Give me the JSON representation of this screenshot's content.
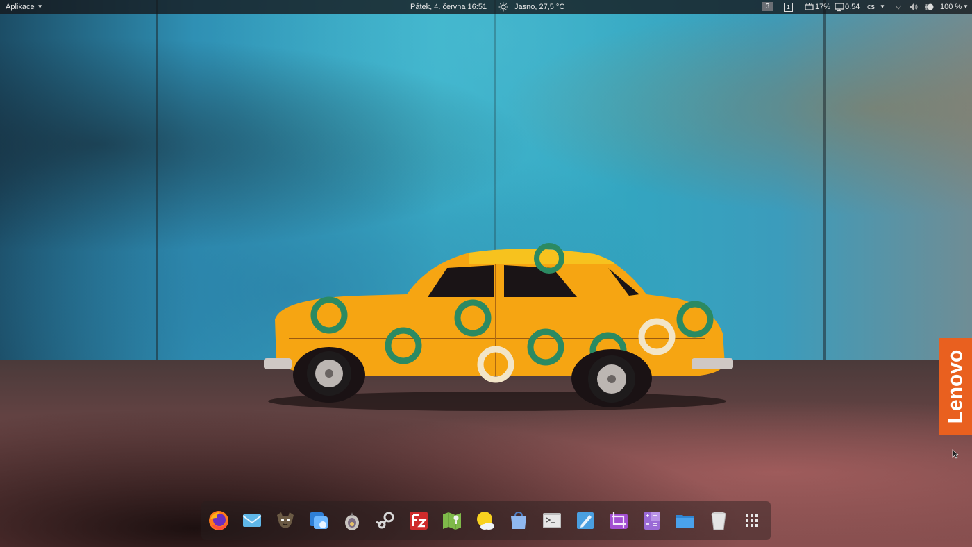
{
  "top_panel": {
    "apps_menu_label": "Aplikace",
    "clock": "Pátek, 4. června  16:51",
    "weather": "Jasno, 27,5 °C",
    "workspace_current": "3",
    "workspace_other": "1",
    "memory_usage": "17%",
    "cpu_load": "0.54",
    "keyboard_layout": "cs",
    "battery_level": "100 %"
  },
  "wallpaper": {
    "brand_tab_text": "Lenovo",
    "brand_color": "#e9601f"
  },
  "dock": {
    "items": [
      {
        "icon": "firefox-icon"
      },
      {
        "icon": "mail-icon"
      },
      {
        "icon": "gimp-icon"
      },
      {
        "icon": "virtualbox-icon"
      },
      {
        "icon": "tor-icon"
      },
      {
        "icon": "steam-icon"
      },
      {
        "icon": "filezilla-icon"
      },
      {
        "icon": "maps-icon"
      },
      {
        "icon": "weather-icon"
      },
      {
        "icon": "appcenter-icon"
      },
      {
        "icon": "terminal-icon"
      },
      {
        "icon": "text-editor-icon"
      },
      {
        "icon": "screenshot-crop-icon"
      },
      {
        "icon": "calculator-icon"
      },
      {
        "icon": "files-icon"
      },
      {
        "icon": "trash-icon"
      },
      {
        "icon": "app-grid-icon"
      }
    ]
  }
}
